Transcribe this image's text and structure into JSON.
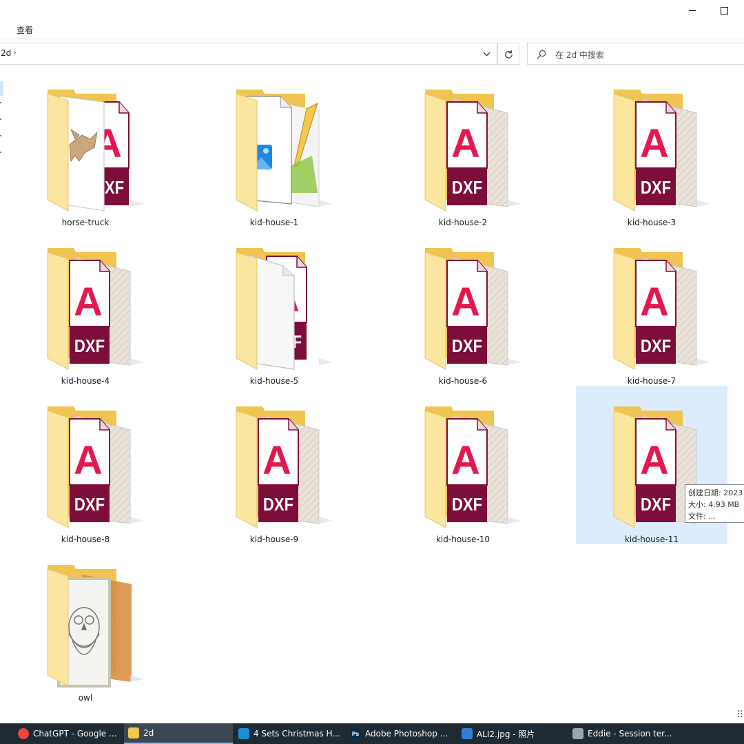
{
  "menu": {
    "view_label": "查看"
  },
  "address": {
    "crumb": "2d",
    "separator": "›"
  },
  "search": {
    "placeholder": "在 2d 中搜索"
  },
  "files": [
    {
      "name": "horse-truck",
      "thumb": "horse-picture"
    },
    {
      "name": "kid-house-1",
      "thumb": "image-and-pencil"
    },
    {
      "name": "kid-house-2",
      "thumb": "dxf"
    },
    {
      "name": "kid-house-3",
      "thumb": "dxf"
    },
    {
      "name": "kid-house-4",
      "thumb": "dxf"
    },
    {
      "name": "kid-house-5",
      "thumb": "blank-and-dxf"
    },
    {
      "name": "kid-house-6",
      "thumb": "dxf"
    },
    {
      "name": "kid-house-7",
      "thumb": "dxf"
    },
    {
      "name": "kid-house-8",
      "thumb": "dxf"
    },
    {
      "name": "kid-house-9",
      "thumb": "dxf"
    },
    {
      "name": "kid-house-10",
      "thumb": "dxf"
    },
    {
      "name": "kid-house-11",
      "thumb": "dxf",
      "selected": true
    },
    {
      "name": "owl",
      "thumb": "owl-picture"
    }
  ],
  "dxf_badge": {
    "letter": "A",
    "text": "DXF"
  },
  "tooltip": {
    "created": "创建日期: 2023",
    "size": "大小: 4.93 MB",
    "files": "文件: ..."
  },
  "taskbar": [
    {
      "label": "ChatGPT - Google ...",
      "icon": "chrome-icon",
      "color": "#e8453c"
    },
    {
      "label": "2d",
      "icon": "folder-icon",
      "color": "#f2c94c",
      "active": true
    },
    {
      "label": "4 Sets Christmas H...",
      "icon": "edge-icon",
      "color": "#1d8fd6"
    },
    {
      "label": "Adobe Photoshop ...",
      "icon": "photoshop-icon",
      "color": "#0b2a4a",
      "glyph": "Ps"
    },
    {
      "label": "ALI2.jpg - 照片",
      "icon": "photos-icon",
      "color": "#2f7fd9"
    },
    {
      "label": "Eddie - Session ter...",
      "icon": "session-icon",
      "color": "#9aa7b3"
    }
  ],
  "colors": {
    "folder_back": "#f0c451",
    "folder_front": "#fbe6a0",
    "dxf_red": "#7d0d3b",
    "dxf_pink": "#e3194d",
    "selection": "#dcecfc"
  }
}
